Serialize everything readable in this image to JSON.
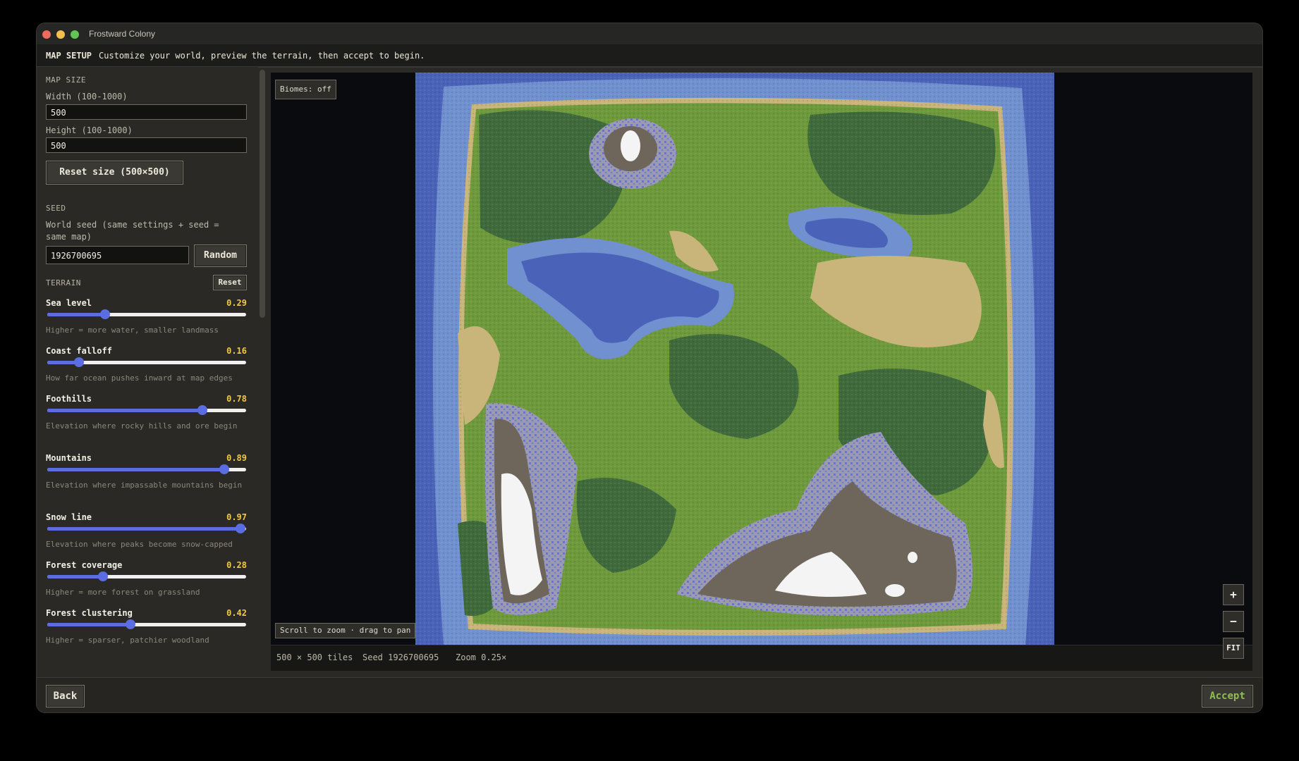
{
  "window": {
    "title": "Frostward Colony"
  },
  "setup_bar": {
    "tag": "MAP SETUP",
    "text": "Customize your world, preview the terrain, then accept to begin."
  },
  "sidebar": {
    "map_size": {
      "title": "MAP SIZE",
      "width_label": "Width (100-1000)",
      "width_value": "500",
      "height_label": "Height (100-1000)",
      "height_value": "500",
      "reset_label": "Reset size (500×500)"
    },
    "seed": {
      "title": "SEED",
      "description": "World seed (same settings + seed = same map)",
      "value": "1926700695",
      "random_label": "Random"
    },
    "terrain": {
      "title": "TERRAIN",
      "reset_label": "Reset",
      "sliders": [
        {
          "label": "Sea level",
          "value": 0.29,
          "display": "0.29",
          "description": "Higher = more water, smaller landmass"
        },
        {
          "label": "Coast falloff",
          "value": 0.16,
          "display": "0.16",
          "description": "How far ocean pushes inward at map edges"
        },
        {
          "label": "Foothills",
          "value": 0.78,
          "display": "0.78",
          "description": "Elevation where rocky hills and ore begin"
        },
        {
          "label": "Mountains",
          "value": 0.89,
          "display": "0.89",
          "description": "Elevation where impassable mountains begin"
        },
        {
          "label": "Snow line",
          "value": 0.97,
          "display": "0.97",
          "description": "Elevation where peaks become snow-capped"
        },
        {
          "label": "Forest coverage",
          "value": 0.28,
          "display": "0.28",
          "description": "Higher = more forest on grassland"
        },
        {
          "label": "Forest clustering",
          "value": 0.42,
          "display": "0.42",
          "description": "Higher = sparser, patchier woodland"
        }
      ]
    }
  },
  "map": {
    "biomes_toggle": "Biomes: off",
    "hint": "Scroll to zoom · drag to pan",
    "zoom_in": "+",
    "zoom_out": "−",
    "fit": "FIT",
    "colors": {
      "ocean": "#4a63b8",
      "shallow": "#6f8fd0",
      "sand": "#c9b47a",
      "grass": "#6f9a3c",
      "forest": "#3f6a3c",
      "rock": "#9896a8",
      "mountain": "#6e665a",
      "snow": "#f4f4f4"
    }
  },
  "status": {
    "size": "500 × 500 tiles",
    "seed": "Seed 1926700695",
    "zoom": "Zoom 0.25×"
  },
  "footer": {
    "back_label": "Back",
    "accept_label": "Accept"
  }
}
